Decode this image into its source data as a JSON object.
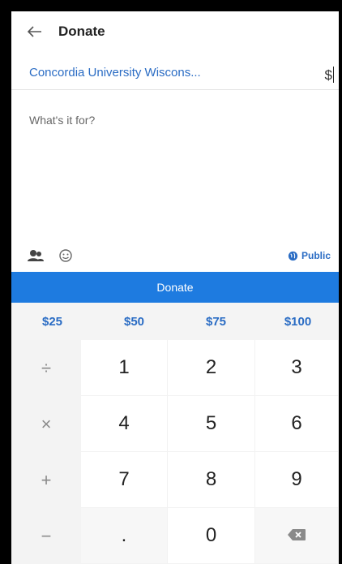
{
  "header": {
    "title": "Donate",
    "back_icon": "back-arrow-icon"
  },
  "recipient": {
    "name": "Concordia University Wiscons...",
    "amount_prefix": "$"
  },
  "note": {
    "placeholder": "What's it for?"
  },
  "toolbar": {
    "people_icon": "people-icon",
    "emoji_icon": "emoji-icon",
    "privacy_label": "Public",
    "privacy_icon": "globe-icon"
  },
  "donate_button": {
    "label": "Donate"
  },
  "presets": [
    "$25",
    "$50",
    "$75",
    "$100"
  ],
  "keypad": {
    "ops": [
      "÷",
      "×",
      "+",
      "−"
    ],
    "rows": [
      [
        "1",
        "2",
        "3"
      ],
      [
        "4",
        "5",
        "6"
      ],
      [
        "7",
        "8",
        "9"
      ],
      [
        ".",
        "0",
        ""
      ]
    ],
    "backspace_icon": "backspace-icon"
  },
  "colors": {
    "accent": "#1e7be0",
    "link": "#2a6cc4"
  }
}
